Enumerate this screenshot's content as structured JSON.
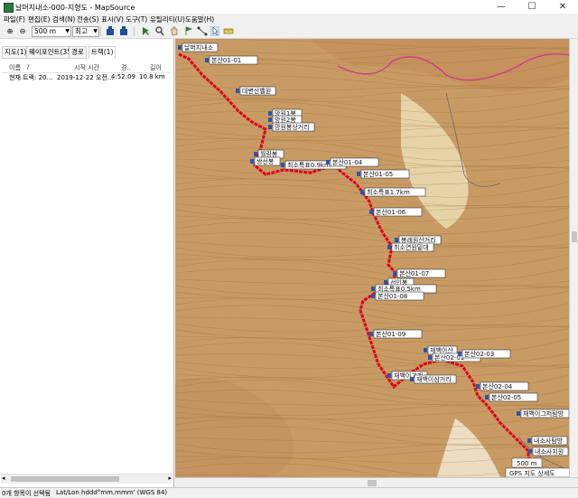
{
  "window": {
    "title": "날머지내소-000-지형도 - MapSource",
    "minimize": "—",
    "maximize": "☐",
    "close": "✕"
  },
  "menu": [
    "파일(F)",
    "편집(E)",
    "검색(N)",
    "전송(S)",
    "표시(V)",
    "도구(T)",
    "유틸리티(U)",
    "도움말(H)"
  ],
  "toolbar": {
    "zoom_in": "⊕",
    "zoom_out": "⊖",
    "scale_value": "500 m",
    "detail_value": "최고"
  },
  "tabs": [
    "지도(1)",
    "웨이포인트(35)",
    "경로",
    "트랙(1)"
  ],
  "active_tab": 3,
  "track_table": {
    "headers": [
      "이름",
      "/",
      "시작 시간",
      "경..",
      "길이"
    ],
    "rows": [
      [
        "현재 트랙: 20...",
        "2019-12-22 오전...",
        "4:52:09",
        "10.8 km"
      ]
    ]
  },
  "map": {
    "waypoint_labels": [
      "날머지내소",
      "본산01-01",
      "대변산벨원",
      "망원1봉",
      "망원2봉",
      "망원봉상거리",
      "월랑봉",
      "쌍선봉",
      "최소특표0.9km",
      "본산01-04",
      "본산01-05",
      "최소특표1.7km",
      "본산01-06",
      "봉래원산거리",
      "최소연원밑대",
      "본산01-07",
      "선인봉",
      "최소특표0.5km",
      "본산01-08",
      "본산01-09",
      "재백이고개",
      "재백이삼거리",
      "재백이산",
      "본산02-01",
      "본산02-03",
      "본산02-04",
      "본산02-05",
      "재백이그저탐방",
      "내소사탐방",
      "내소사지원"
    ],
    "scale_label": "500 m",
    "gps_detail_label": "GPS 지도 상세도"
  },
  "status": {
    "selection": "0개 항목이 선택됨",
    "coord_format": "Lat/Lon hddd°mm.mmm' (WGS 84)"
  }
}
